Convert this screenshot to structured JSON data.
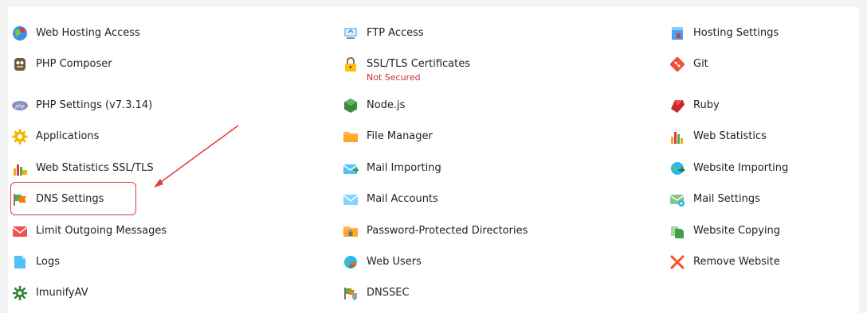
{
  "columns": {
    "col1": [
      {
        "label": "Web Hosting Access",
        "icon": "globe-user-icon"
      },
      {
        "label": "PHP Composer",
        "icon": "composer-icon"
      },
      {
        "label": "PHP Settings (v7.3.14)",
        "icon": "php-icon"
      },
      {
        "label": "Applications",
        "icon": "gear-icon"
      },
      {
        "label": "Web Statistics SSL/TLS",
        "icon": "stats-lock-icon"
      },
      {
        "label": "DNS Settings",
        "icon": "dns-flag-icon"
      },
      {
        "label": "Limit Outgoing Messages",
        "icon": "envelope-red-icon"
      },
      {
        "label": "Logs",
        "icon": "document-icon"
      },
      {
        "label": "ImunifyAV",
        "icon": "shield-virus-icon"
      }
    ],
    "col2": [
      {
        "label": "FTP Access",
        "icon": "ftp-monitor-icon"
      },
      {
        "label": "SSL/TLS Certificates",
        "sub": "Not Secured",
        "icon": "padlock-icon"
      },
      {
        "label": "Node.js",
        "icon": "nodejs-hexagon-icon"
      },
      {
        "label": "File Manager",
        "icon": "folder-icon"
      },
      {
        "label": "Mail Importing",
        "icon": "mail-import-icon"
      },
      {
        "label": "Mail Accounts",
        "icon": "envelope-icon"
      },
      {
        "label": "Password-Protected Directories",
        "icon": "folder-lock-icon"
      },
      {
        "label": "Web Users",
        "icon": "globe-users-icon"
      },
      {
        "label": "DNSSEC",
        "icon": "dnssec-shield-icon"
      }
    ],
    "col3": [
      {
        "label": "Hosting Settings",
        "icon": "server-icon"
      },
      {
        "label": "Git",
        "icon": "git-icon"
      },
      {
        "label": "Ruby",
        "icon": "ruby-icon"
      },
      {
        "label": "Web Statistics",
        "icon": "bar-chart-icon"
      },
      {
        "label": "Website Importing",
        "icon": "globe-import-icon"
      },
      {
        "label": "Mail Settings",
        "icon": "mail-settings-icon"
      },
      {
        "label": "Website Copying",
        "icon": "copy-icon"
      },
      {
        "label": "Remove Website",
        "icon": "remove-x-icon"
      }
    ]
  },
  "annotation": {
    "highlighted_item": "DNS Settings",
    "color": "#e03b3b"
  }
}
